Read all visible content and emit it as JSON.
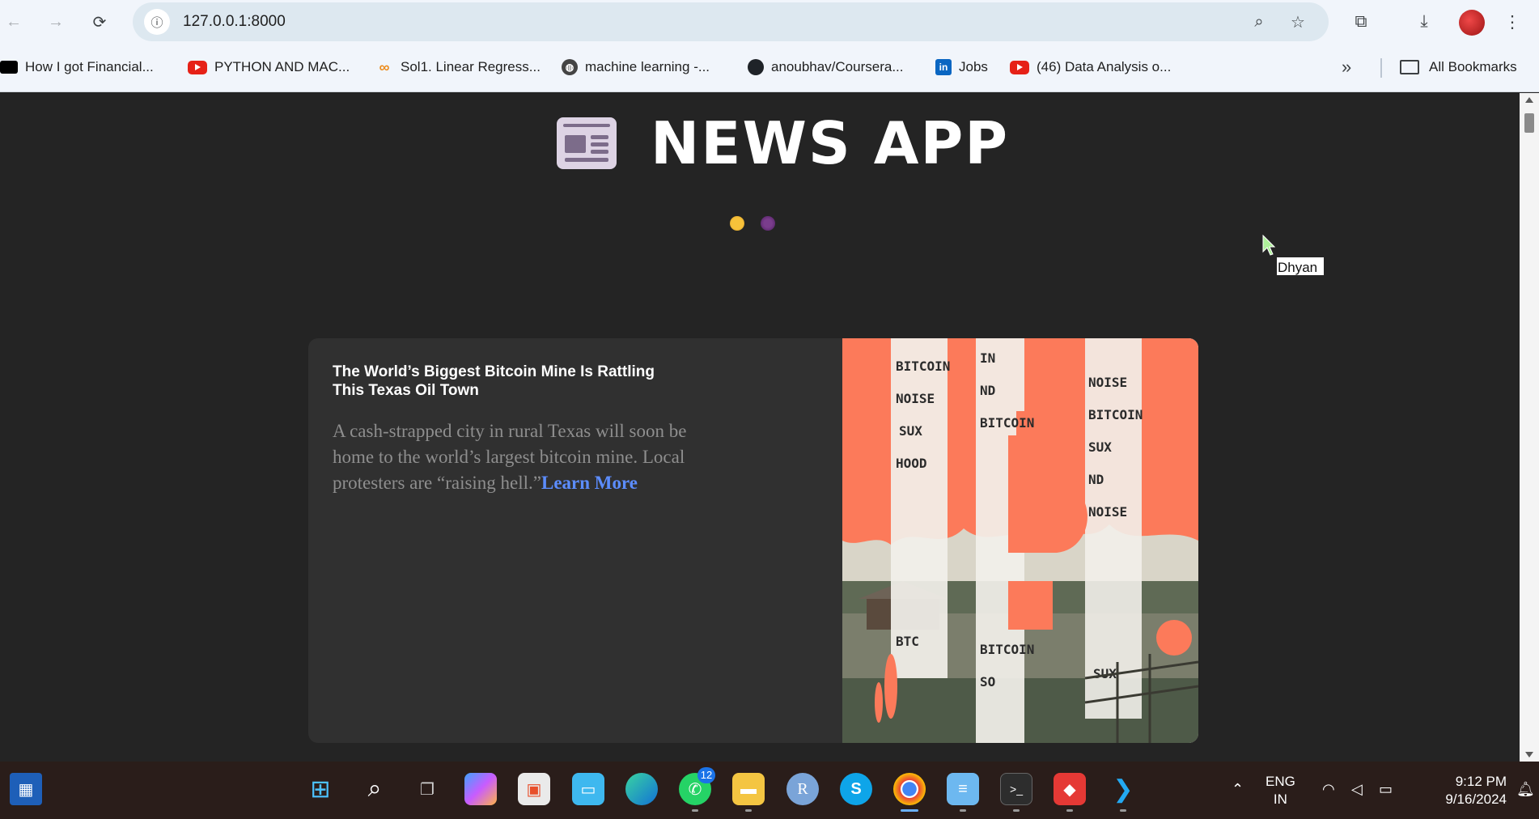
{
  "browser": {
    "url": "127.0.0.1:8000",
    "bookmarks": [
      {
        "label": "How I got Financial...",
        "icon": "video-icon"
      },
      {
        "label": "PYTHON AND MAC...",
        "icon": "youtube-icon"
      },
      {
        "label": "Sol1. Linear Regress...",
        "icon": "coursera-icon"
      },
      {
        "label": "machine learning -...",
        "icon": "globe-icon"
      },
      {
        "label": "anoubhav/Coursera...",
        "icon": "github-icon"
      },
      {
        "label": "Jobs",
        "icon": "linkedin-icon"
      },
      {
        "label": "(46) Data Analysis o...",
        "icon": "youtube-icon"
      }
    ],
    "all_bookmarks_label": "All Bookmarks",
    "overflow_glyph": "»"
  },
  "app": {
    "title": "NEWS APP",
    "user_name": "Dhyan",
    "theme_toggles": [
      "light-theme",
      "dark-theme"
    ]
  },
  "article": {
    "title": "The World’s Biggest Bitcoin Mine Is Rattling This Texas Oil Town",
    "description": "A cash-strapped city in rural Texas will soon be home to the world’s largest bitcoin mine. Local protesters are “raising hell.”",
    "link_label": "Learn More",
    "image_words": [
      "BITCOIN",
      "NOISE",
      "SUX",
      "HOOD",
      "IN",
      "ND",
      "BTC",
      "SO"
    ]
  },
  "taskbar": {
    "whatsapp_badge": "12",
    "lang_line1": "ENG",
    "lang_line2": "IN",
    "time": "9:12 PM",
    "date": "9/16/2024"
  },
  "colors": {
    "page_bg": "#242424",
    "card_bg": "#303030",
    "link": "#5c8dff",
    "image_orange": "#fc7a5a"
  }
}
